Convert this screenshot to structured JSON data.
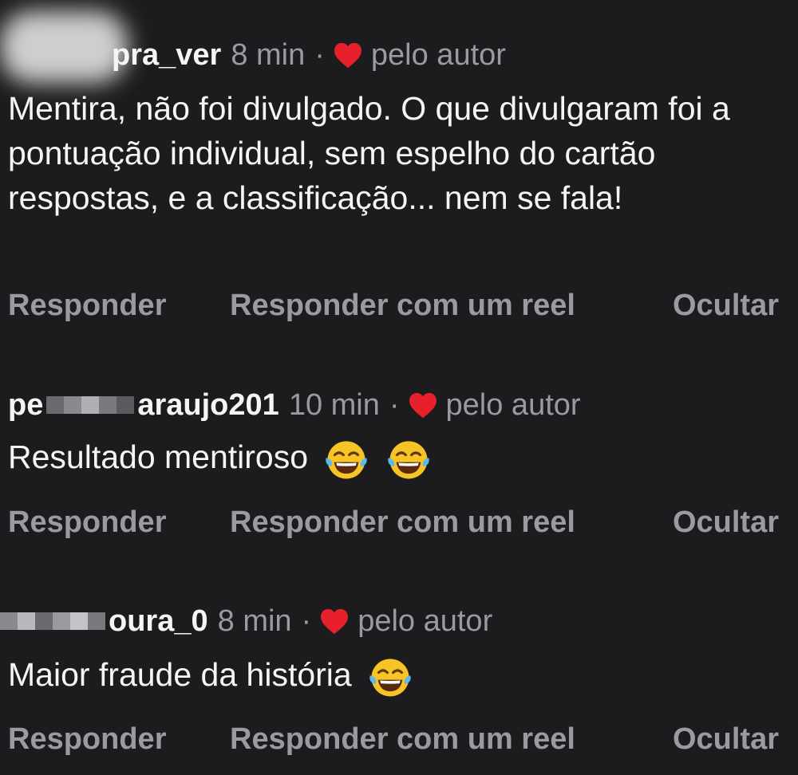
{
  "comments": [
    {
      "username": "pra_ver",
      "time": "8 min",
      "separator": "·",
      "by_author": "pelo autor",
      "text": "Mentira, não foi divulgado. O que divulgaram foi a pontuação individual, sem espelho do cartão respostas, e a classificação... nem se fala!",
      "emojis": []
    },
    {
      "username_prefix": "pe",
      "username": "araujo201",
      "time": "10 min",
      "separator": "·",
      "by_author": "pelo autor",
      "text": "Resultado mentiroso",
      "emojis": [
        "face-with-tears-of-joy",
        "face-with-tears-of-joy"
      ]
    },
    {
      "username": "oura_0",
      "time": "8 min",
      "separator": "·",
      "by_author": "pelo autor",
      "text": "Maior fraude da história",
      "emojis": [
        "face-with-tears-of-joy"
      ]
    }
  ],
  "actions": {
    "reply": "Responder",
    "reply_reel": "Responder com um reel",
    "hide": "Ocultar"
  },
  "colors": {
    "background": "#1c1c1e",
    "text": "#f5f5f5",
    "muted": "#9a9aa0",
    "heart": "#e8202c"
  },
  "icons": {
    "heart": "heart-icon",
    "emoji": "face-with-tears-of-joy-icon"
  }
}
